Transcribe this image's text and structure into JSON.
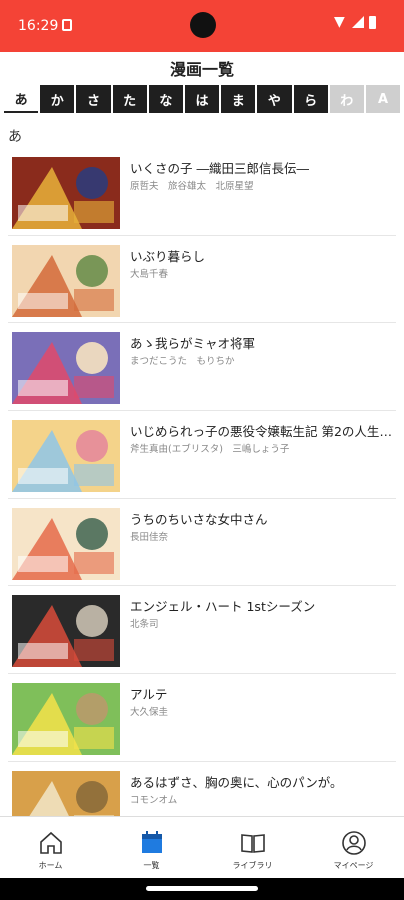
{
  "status_bar": {
    "time": "16:29"
  },
  "page_title": "漫画一覧",
  "kana_tabs": [
    {
      "label": "あ",
      "state": "active"
    },
    {
      "label": "か",
      "state": "normal"
    },
    {
      "label": "さ",
      "state": "normal"
    },
    {
      "label": "た",
      "state": "normal"
    },
    {
      "label": "な",
      "state": "normal"
    },
    {
      "label": "は",
      "state": "normal"
    },
    {
      "label": "ま",
      "state": "normal"
    },
    {
      "label": "や",
      "state": "normal"
    },
    {
      "label": "ら",
      "state": "normal"
    },
    {
      "label": "わ",
      "state": "disabled"
    },
    {
      "label": "A",
      "state": "disabled"
    }
  ],
  "section_header": "あ",
  "manga": [
    {
      "title": "いくさの子 ―織田三郎信長伝―",
      "authors": "原哲夫　旅谷雄太　北原星望",
      "cover_colors": [
        "#8a2b1c",
        "#e7b23a",
        "#2d3b7a"
      ]
    },
    {
      "title": "いぶり暮らし",
      "authors": "大島千春",
      "cover_colors": [
        "#f2d6b0",
        "#d46a3a",
        "#6b8f4e"
      ]
    },
    {
      "title": "あゝ我らがミャオ将軍",
      "authors": "まつだこうた　もりちか",
      "cover_colors": [
        "#7a6fb8",
        "#e04a6a",
        "#f6e2c0"
      ]
    },
    {
      "title": "いじめられっ子の悪役令嬢転生記 第2の人生も…",
      "authors": "斧生真由(エブリスタ)　三嶋しょう子",
      "cover_colors": [
        "#f4d38a",
        "#8ec5e8",
        "#e58a9a"
      ]
    },
    {
      "title": "うちのちいさな女中さん",
      "authors": "長田佳奈",
      "cover_colors": [
        "#f6e4c8",
        "#e56b4a",
        "#4a6b58"
      ]
    },
    {
      "title": "エンジェル・ハート 1stシーズン",
      "authors": "北条司",
      "cover_colors": [
        "#2a2a2a",
        "#d84b3a",
        "#c9c0b0"
      ]
    },
    {
      "title": "アルテ",
      "authors": "大久保圭",
      "cover_colors": [
        "#7fbf5a",
        "#f5e24a",
        "#b99a6a"
      ]
    },
    {
      "title": "あるはずさ、胸の奥に、心のパンが。",
      "authors": "コモンオム",
      "cover_colors": [
        "#d8a04a",
        "#f2e6c8",
        "#8c6b3a"
      ]
    }
  ],
  "bottom_nav": [
    {
      "label": "ホーム",
      "icon": "home-icon",
      "active": false
    },
    {
      "label": "一覧",
      "icon": "calendar-icon",
      "active": true
    },
    {
      "label": "ライブラリ",
      "icon": "book-icon",
      "active": false
    },
    {
      "label": "マイページ",
      "icon": "user-icon",
      "active": false
    }
  ],
  "colors": {
    "status_bar": "#f44336",
    "accent": "#1f7be0",
    "tab_dark": "#1f1f1f",
    "tab_disabled": "#cfcfcf"
  }
}
